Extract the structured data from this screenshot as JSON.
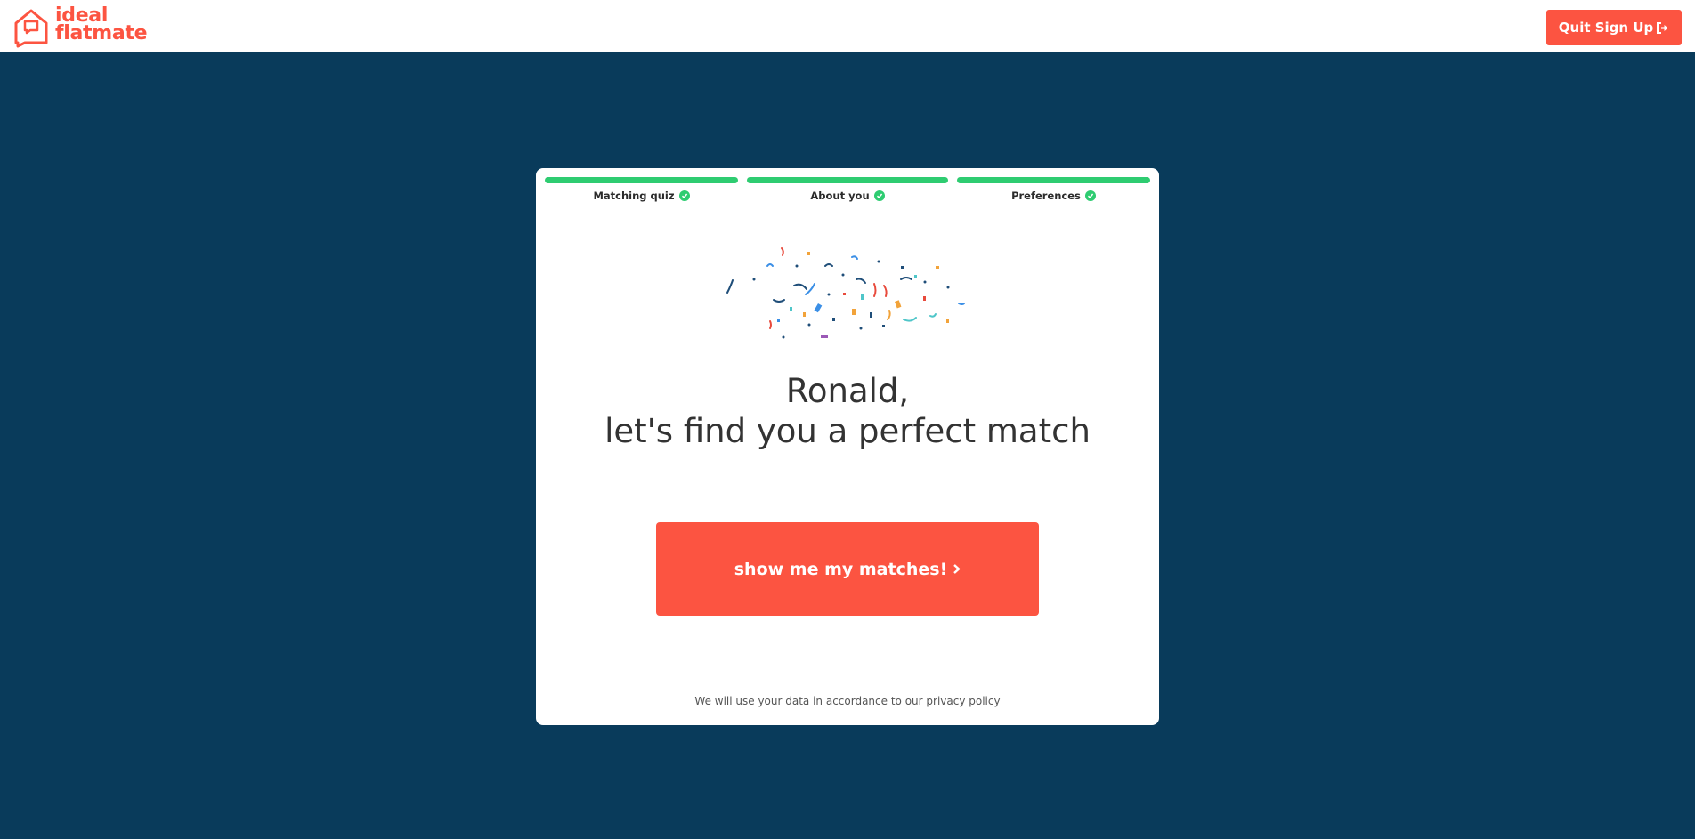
{
  "header": {
    "logo_line1": "ideal",
    "logo_line2": "flatmate",
    "quit_label": "Quit Sign Up",
    "quit_icon": "sign-out-icon"
  },
  "steps": [
    {
      "label": "Matching quiz",
      "complete": true
    },
    {
      "label": "About you",
      "complete": true
    },
    {
      "label": "Preferences",
      "complete": true
    }
  ],
  "greeting": {
    "name_line": "Ronald,",
    "tagline": "let's find you a perfect match"
  },
  "cta": {
    "label": "show me my matches!",
    "icon": "chevron-right-icon"
  },
  "footer": {
    "text": "We will use your data in accordance to our",
    "link": "privacy policy"
  },
  "colors": {
    "background": "#093b5b",
    "accent": "#fc5441",
    "success": "#2ecc71"
  }
}
